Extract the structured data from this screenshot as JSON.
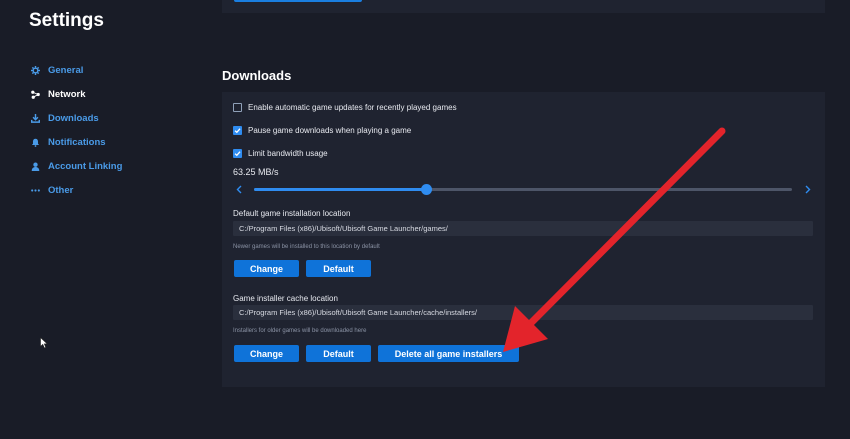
{
  "sidebar": {
    "title": "Settings",
    "items": [
      {
        "label": "General",
        "icon": "gear-icon",
        "active": false
      },
      {
        "label": "Network",
        "icon": "network-icon",
        "active": true
      },
      {
        "label": "Downloads",
        "icon": "download-icon",
        "active": false
      },
      {
        "label": "Notifications",
        "icon": "bell-icon",
        "active": false
      },
      {
        "label": "Account Linking",
        "icon": "user-icon",
        "active": false
      },
      {
        "label": "Other",
        "icon": "ellipsis-icon",
        "active": false
      }
    ]
  },
  "downloads": {
    "title": "Downloads",
    "auto_updates": {
      "label": "Enable automatic game updates for recently played games",
      "checked": false
    },
    "pause_downloads": {
      "label": "Pause game downloads when playing a game",
      "checked": true
    },
    "limit_bandwidth": {
      "label": "Limit bandwidth usage",
      "checked": true
    },
    "bandwidth": {
      "value_text": "63.25 MB/s",
      "slider_fraction": 0.32
    },
    "install_location": {
      "label": "Default game installation location",
      "path": "C:/Program Files (x86)/Ubisoft/Ubisoft Game Launcher/games/",
      "hint": "Newer games will be installed to this location by default",
      "change_label": "Change",
      "default_label": "Default"
    },
    "cache_location": {
      "label": "Game installer cache location",
      "path": "C:/Program Files (x86)/Ubisoft/Ubisoft Game Launcher/cache/installers/",
      "hint": "Installers for older games will be downloaded here",
      "change_label": "Change",
      "default_label": "Default",
      "delete_label": "Delete all game installers"
    }
  },
  "colors": {
    "background": "#191c27",
    "panel": "#1f2330",
    "accent": "#2f8cf0",
    "button": "#0f73d9",
    "link": "#4a9be8",
    "annotation_arrow": "#e3242b"
  }
}
